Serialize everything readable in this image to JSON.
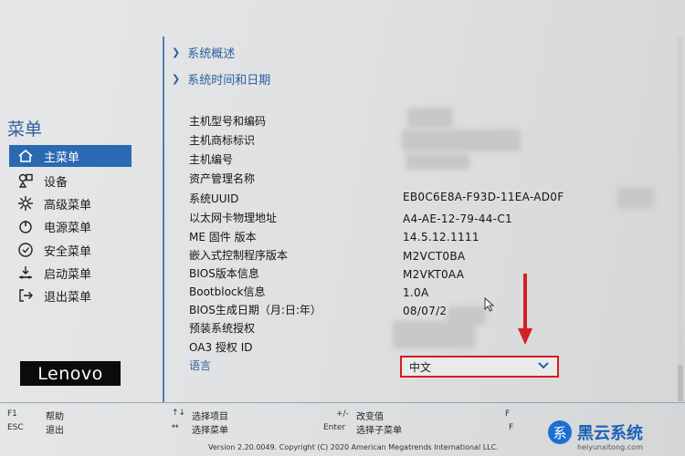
{
  "top_links": [
    {
      "label": "系统概述"
    },
    {
      "label": "系统时间和日期"
    }
  ],
  "sidebar": {
    "title": "菜单",
    "items": [
      {
        "label": "主菜单",
        "icon": "home-icon",
        "active": true
      },
      {
        "label": "设备",
        "icon": "devices-icon",
        "active": false
      },
      {
        "label": "高级菜单",
        "icon": "advanced-icon",
        "active": false
      },
      {
        "label": "电源菜单",
        "icon": "power-icon",
        "active": false
      },
      {
        "label": "安全菜单",
        "icon": "security-icon",
        "active": false
      },
      {
        "label": "启动菜单",
        "icon": "boot-icon",
        "active": false
      },
      {
        "label": "退出菜单",
        "icon": "exit-icon",
        "active": false
      }
    ],
    "brand": "Lenovo"
  },
  "info_rows": [
    {
      "label": "主机型号和编码",
      "value": ""
    },
    {
      "label": "主机商标标识",
      "value": ""
    },
    {
      "label": "主机编号",
      "value": ""
    },
    {
      "label": "资产管理名称",
      "value": ""
    },
    {
      "label": "系统UUID",
      "value": "EB0C6E8A-F93D-11EA-AD0F"
    },
    {
      "label": "以太网卡物理地址",
      "value": "A4-AE-12-79-44-C1"
    },
    {
      "label": "ME 固件 版本",
      "value": "14.5.12.1111"
    },
    {
      "label": "嵌入式控制程序版本",
      "value": "M2VCT0BA"
    },
    {
      "label": "BIOS版本信息",
      "value": "M2VKT0AA"
    },
    {
      "label": "Bootblock信息",
      "value": "1.0A"
    },
    {
      "label": "BIOS生成日期（月:日:年）",
      "value": "08/07/2"
    },
    {
      "label": "预装系统授权",
      "value": ""
    },
    {
      "label": "OA3 授权 ID",
      "value": ""
    }
  ],
  "language": {
    "label": "语言",
    "value": "中文"
  },
  "footer": {
    "keys": [
      {
        "key": "F1",
        "desc": "帮助"
      },
      {
        "key": "ESC",
        "desc": "退出"
      },
      {
        "key": "↑↓",
        "desc": "选择项目"
      },
      {
        "key": "↔",
        "desc": "选择菜单"
      },
      {
        "key": "+/-",
        "desc": "改变值"
      },
      {
        "key": "Enter",
        "desc": "选择子菜单"
      },
      {
        "key": "F",
        "desc": ""
      },
      {
        "key": "F",
        "desc": ""
      }
    ],
    "version": "Version 2.20.0049. Copyright (C) 2020 American Megatrends International LLC."
  },
  "watermark": {
    "badge": "系",
    "text": "黑云系统",
    "sub": "heiyunxitong.com"
  },
  "colors": {
    "accent": "#2b6ab3",
    "highlight": "#d21e24",
    "link": "#2d5fa0"
  }
}
